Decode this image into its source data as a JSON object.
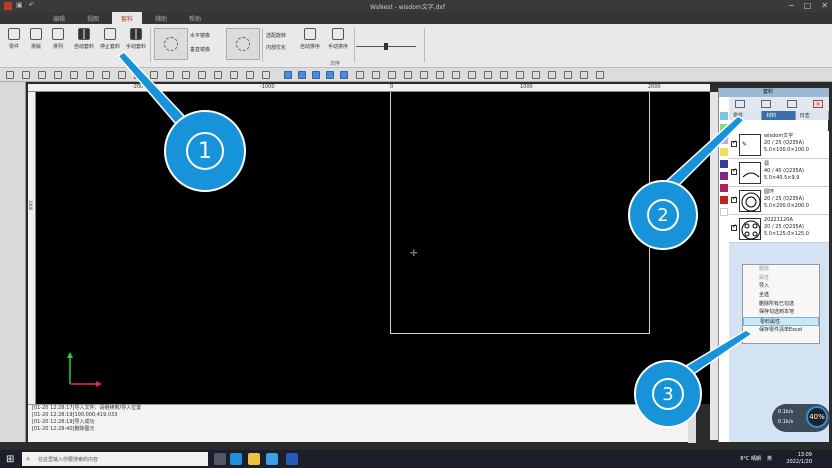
{
  "window": {
    "title": "WsNest - wisdom文字.dxf",
    "controls": [
      "─",
      "□",
      "✕"
    ]
  },
  "menu_tabs": [
    "",
    "编辑",
    "视图",
    "套料",
    "辅助",
    "帮助"
  ],
  "active_tab_index": 3,
  "ribbon": {
    "buttons": [
      {
        "label": "零件",
        "icon": "part-icon"
      },
      {
        "label": "排版",
        "icon": "layout-icon"
      },
      {
        "label": "排列",
        "icon": "arrange-icon"
      },
      {
        "label": "自动套料",
        "icon": "auto-nest-icon"
      },
      {
        "label": "停止套料",
        "icon": "stop-nest-icon"
      },
      {
        "label": "手动套料",
        "icon": "manual-nest-icon"
      }
    ],
    "align_options": [
      "水平镜像",
      "垂直镜像"
    ],
    "check_options": [
      "选配旋转",
      "内部优化"
    ],
    "right_buttons": [
      {
        "label": "自动排序",
        "icon": "auto-sort-icon"
      },
      {
        "label": "手动排序",
        "icon": "manual-sort-icon"
      }
    ],
    "group_label": "次序"
  },
  "ruler": {
    "top_ticks": [
      "-2000",
      "-1000",
      "0",
      "1000",
      "2000"
    ],
    "left_tick": "1000"
  },
  "log": {
    "lines": [
      "[01-20 12:28:17]导入文件：请继续到/导入位置",
      "[01-20 12:28:19]100.000,419.033",
      "[01-20 12:28:19]导入成功",
      "[01-20 12:28:40]删除图元"
    ]
  },
  "right_panel": {
    "header": "套料",
    "tabs": [
      "零件",
      "材料",
      "日志"
    ],
    "active_tab_index": 1,
    "swatch_colors": [
      "#7ec3e6",
      "#8ed87e",
      "#d8a0e0",
      "#f0e060",
      "#3a3a9a",
      "#7a2a8a",
      "#b02060",
      "#c02020",
      "#ffffff"
    ],
    "parts": [
      {
        "name": "wisdom文字",
        "qty": "20 / 25 (Q235A)",
        "size": "5.0×100.0×100.0",
        "checked": true
      },
      {
        "name": "弧",
        "qty": "40 / 40 (Q235A)",
        "size": "5.0×40.5×9.9",
        "checked": true
      },
      {
        "name": "圆环",
        "qty": "20 / 25 (Q235A)",
        "size": "5.0×200.0×200.0",
        "checked": true
      },
      {
        "name": "20221120A",
        "qty": "20 / 25 (Q235A)",
        "size": "5.0×125.0×125.0",
        "checked": true
      }
    ]
  },
  "context_menu": {
    "items": [
      "删除",
      "属性",
      "导入",
      "全选",
      "删除所有已勾选",
      "保存勾选到本地",
      "零料属性",
      "保存零件清单Excel"
    ],
    "disabled": [
      0,
      1
    ],
    "highlighted_index": 6
  },
  "callouts": [
    "1",
    "2",
    "3"
  ],
  "zoom": {
    "percent": "40%",
    "up": "0.1k/s",
    "down": "0.1k/s"
  },
  "taskbar": {
    "search_placeholder": "在这里输入你要搜索的内容",
    "weather": "8°C 晴朗",
    "lang": "英",
    "time": "13:09",
    "date": "2022/1/20"
  }
}
